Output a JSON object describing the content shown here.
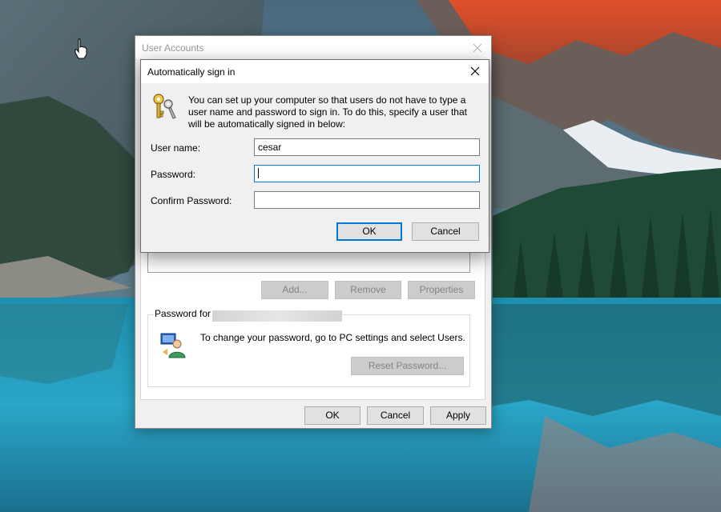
{
  "parent_window": {
    "title": "User Accounts",
    "buttons": {
      "add": "Add...",
      "remove": "Remove",
      "properties": "Properties",
      "ok": "OK",
      "cancel": "Cancel",
      "apply": "Apply"
    },
    "password_group": {
      "label": "Password for",
      "message": "To change your password, go to PC settings and select Users.",
      "reset_button": "Reset Password..."
    }
  },
  "dialog": {
    "title": "Automatically sign in",
    "description": "You can set up your computer so that users do not have to type a user name and password to sign in. To do this, specify a user that will be automatically signed in below:",
    "fields": {
      "user_name": {
        "label": "User name:",
        "value": "cesar"
      },
      "password": {
        "label": "Password:",
        "value": ""
      },
      "confirm_password": {
        "label": "Confirm Password:",
        "value": ""
      }
    },
    "ok_label": "OK",
    "cancel_label": "Cancel"
  },
  "colors": {
    "accent": "#0078d7",
    "dialog_bg": "#f0f0f0",
    "disabled_text": "#838383"
  },
  "icons": {
    "keys": "keys-icon",
    "user_password": "user-password-icon",
    "close": "close-icon",
    "cursor": "hand-cursor-icon"
  }
}
